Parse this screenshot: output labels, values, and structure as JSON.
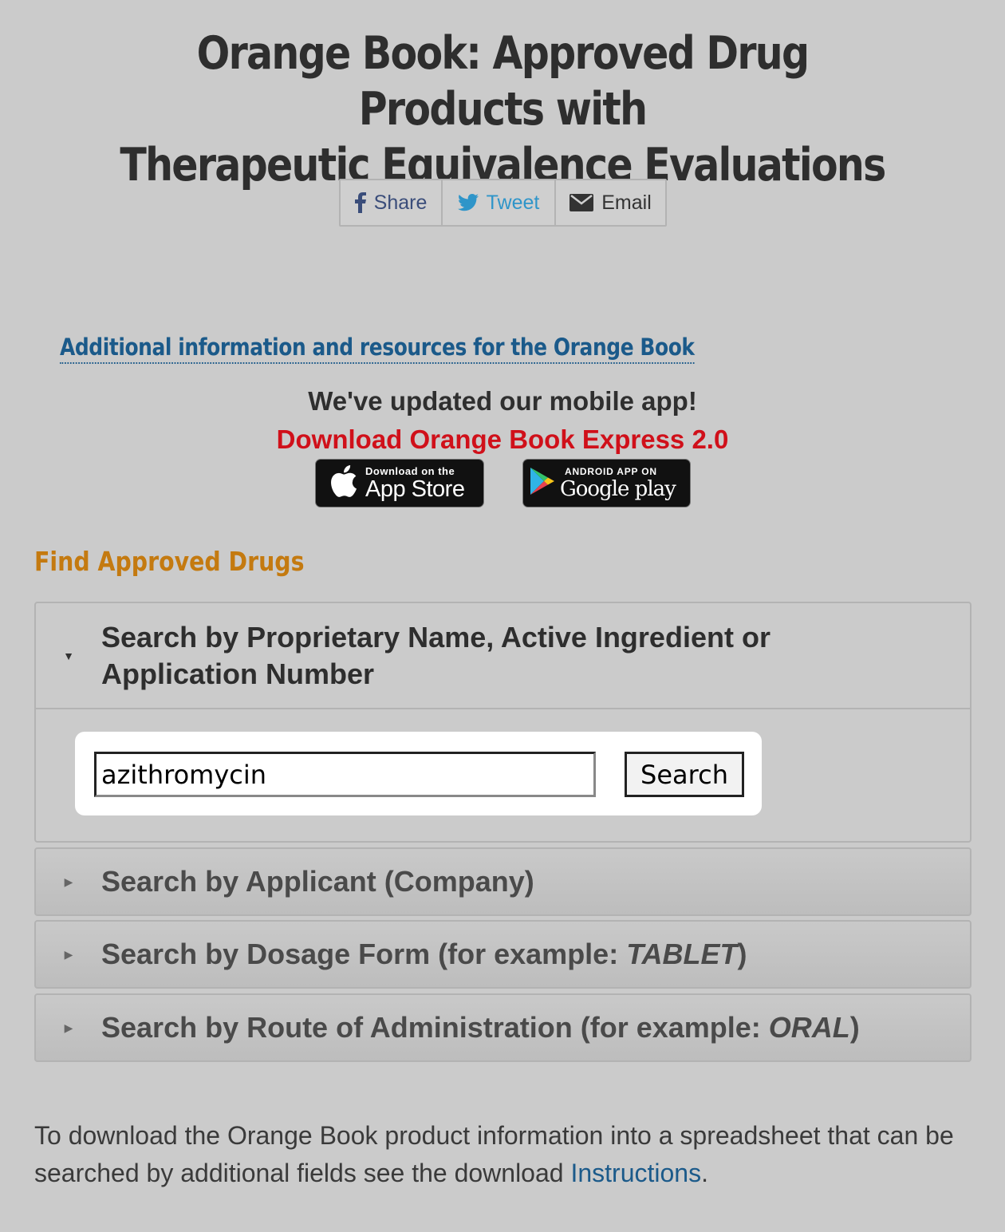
{
  "header": {
    "title_line1": "Orange Book: Approved Drug Products with",
    "title_line2": "Therapeutic Equivalence Evaluations"
  },
  "share": {
    "facebook_label": "Share",
    "twitter_label": "Tweet",
    "email_label": "Email"
  },
  "resources_link": "Additional information and resources for the Orange Book",
  "mobile": {
    "updated_text": "We've updated our mobile app!",
    "download_text": "Download Orange Book Express 2.0",
    "app_store_small": "Download on the",
    "app_store_big": "App Store",
    "google_play_small": "ANDROID APP ON",
    "google_play_big": "Google play"
  },
  "find": {
    "heading": "Find Approved Drugs"
  },
  "accordion": {
    "open_panel": {
      "title_line1": "Search by Proprietary Name, Active Ingredient or",
      "title_line2": "Application Number"
    },
    "search_input_value": "azithromycin",
    "search_button_label": "Search",
    "applicant": "Search by Applicant (Company)",
    "dosage_prefix": "Search by Dosage Form (for example: ",
    "dosage_example": "TABLET",
    "dosage_suffix": ")",
    "route_prefix": "Search by Route of Administration (for example: ",
    "route_example": "ORAL",
    "route_suffix": ")"
  },
  "footer": {
    "text_before_link": "To download the Orange Book product information into a spreadsheet that can be searched by additional fields see the download ",
    "link_text": "Instructions",
    "text_after_link": "."
  },
  "colors": {
    "background": "#cbcbcb",
    "link_blue": "#1b5a8a",
    "download_red": "#d0101a",
    "heading_orange": "#c47a10",
    "twitter_blue": "#2f95c9"
  }
}
